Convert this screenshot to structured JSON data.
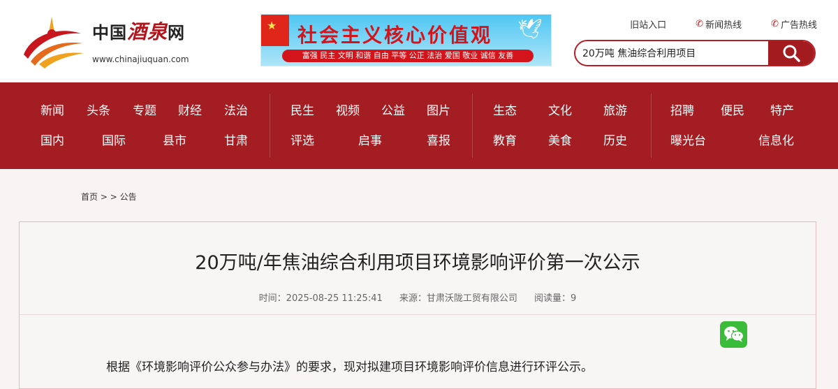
{
  "header": {
    "logo_prefix": "中国",
    "logo_calligraphy": "酒泉",
    "logo_suffix": "网",
    "logo_url": "www.chinajiuquan.com",
    "banner_title": "社会主义核心价值观",
    "banner_values": "富强 民主 文明 和谐 自由 平等 公正 法治 爱国 敬业 诚信 友善",
    "links": [
      "旧站入口",
      "新闻热线",
      "广告热线"
    ],
    "search_value": "20万吨 焦油综合利用项目"
  },
  "nav": {
    "row1": [
      "新闻",
      "头条",
      "专题",
      "财经",
      "法治",
      "民生",
      "视频",
      "公益",
      "图片",
      "生态",
      "文化",
      "旅游",
      "招聘",
      "便民",
      "特产"
    ],
    "row2": [
      "国内",
      "国际",
      "县市",
      "甘肃",
      "评选",
      "启事",
      "喜报",
      "教育",
      "美食",
      "历史",
      "曝光台",
      "信息化"
    ]
  },
  "breadcrumb": {
    "home": "首页",
    "sep": " > > ",
    "current": "公告"
  },
  "article": {
    "title": "20万吨/年焦油综合利用项目环境影响评价第一次公示",
    "time": "时间：2025-08-25 11:25:41",
    "source": "来源：甘肃沃陇工贸有限公司",
    "reads": "阅读量：9",
    "body": "根据《环境影响评价公众参与办法》的要求，现对拟建项目环境影响评价信息进行环评公示。"
  },
  "colors": {
    "brand_red": "#a31d22",
    "wechat_green": "#3bbb3a"
  },
  "icons": [
    "logo-emblem-icon",
    "flag-star-icon",
    "dove-icon",
    "phone-icon",
    "search-icon",
    "wechat-icon"
  ]
}
